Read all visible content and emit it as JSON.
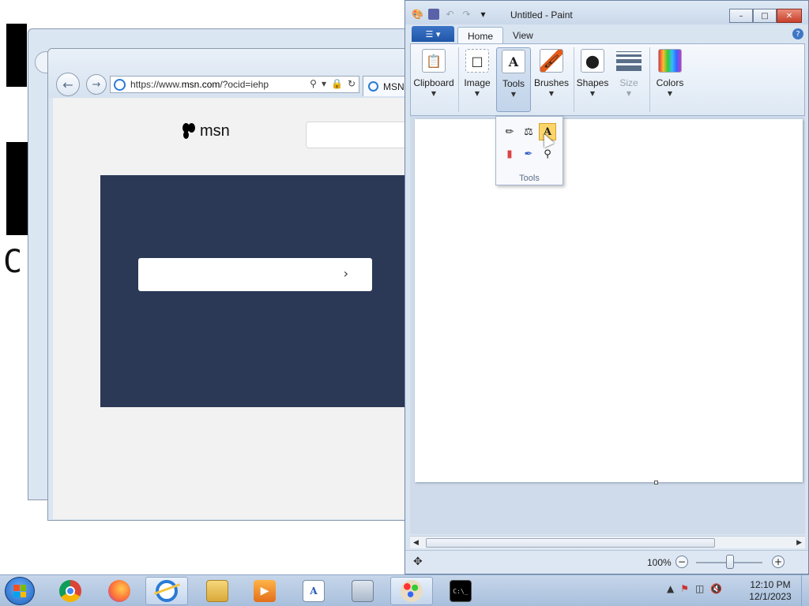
{
  "desktop": {
    "bg_letter": "C"
  },
  "ie": {
    "address": "https://www.msn.com/?ocid=iehp",
    "address_prefix": "https://www.",
    "address_domain": "msn.com",
    "address_suffix": "/?ocid=iehp",
    "tab_label": "MSN",
    "logo_text": "msn",
    "hero_color": "#2b3856"
  },
  "paint": {
    "title": "Untitled - Paint",
    "tabs": {
      "home": "Home",
      "view": "View"
    },
    "groups": {
      "clipboard": "Clipboard",
      "image": "Image",
      "tools": "Tools",
      "brushes": "Brushes",
      "shapes": "Shapes",
      "size": "Size",
      "colors": "Colors"
    },
    "tools_popup": {
      "label": "Tools",
      "tools": [
        "pencil-icon",
        "fill-icon",
        "text-icon",
        "eraser-icon",
        "color-picker-icon",
        "magnifier-icon"
      ],
      "selected": "text-icon"
    },
    "zoom": "100%",
    "accent": "#1f56a8"
  },
  "taskbar": {
    "apps": [
      "chrome-icon",
      "firefox-icon",
      "ie-icon",
      "explorer-icon",
      "media-player-icon",
      "wordpad-icon",
      "calculator-icon",
      "paint-icon",
      "cmd-icon"
    ],
    "active": [
      "ie-icon",
      "paint-icon"
    ],
    "time": "12:10 PM",
    "date": "12/1/2023"
  }
}
